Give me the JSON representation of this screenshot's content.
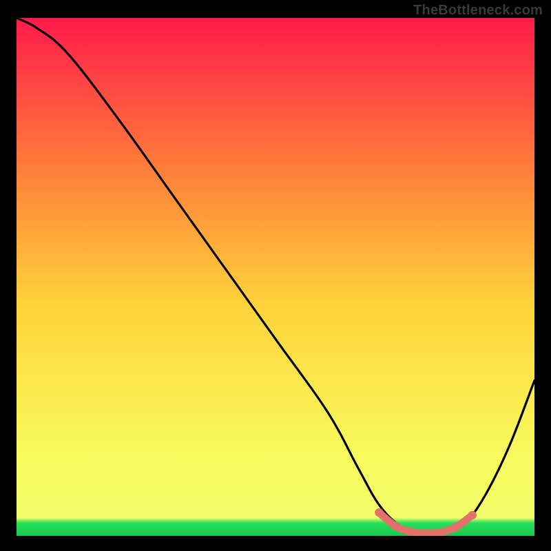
{
  "watermark": "TheBottleneck.com",
  "colors": {
    "bg": "#000000",
    "curve": "#000000",
    "highlight": "#e2716b",
    "grad_top": "#ff1a4b",
    "grad_mid_upper": "#ff7a3a",
    "grad_mid": "#ffd23a",
    "grad_mid_lower": "#f8f85a",
    "grad_bottom": "#26e05a",
    "watermark_text": "#3a3a3a"
  },
  "chart_data": {
    "type": "line",
    "title": "",
    "xlabel": "",
    "ylabel": "",
    "xlim": [
      0,
      100
    ],
    "ylim": [
      0,
      100
    ],
    "series": [
      {
        "name": "bottleneck-curve",
        "x": [
          0,
          4,
          10,
          20,
          30,
          40,
          50,
          60,
          66,
          70,
          74,
          78,
          82,
          86,
          90,
          95,
          100
        ],
        "y": [
          100,
          98,
          93,
          80,
          66,
          52,
          38,
          24,
          13,
          6,
          2,
          0.5,
          0.5,
          2,
          7,
          17,
          30
        ]
      },
      {
        "name": "optimal-range-highlight",
        "x": [
          70,
          73,
          76,
          79,
          82,
          85,
          88
        ],
        "y": [
          4.5,
          2.0,
          0.8,
          0.5,
          0.7,
          1.8,
          4.0
        ]
      }
    ],
    "annotations": []
  }
}
